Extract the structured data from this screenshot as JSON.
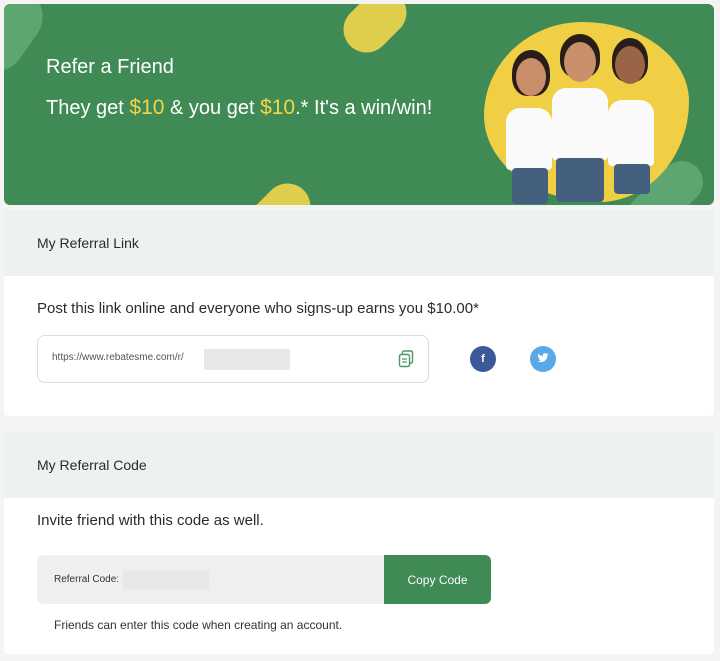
{
  "banner": {
    "title": "Refer a Friend",
    "tagline_pre": "They get ",
    "amount_friend": "$10",
    "tagline_mid": " & you get ",
    "amount_you": "$10",
    "tagline_post": ".* It's a win/win!"
  },
  "referral_link": {
    "heading": "My Referral Link",
    "description": "Post this link online and everyone who signs-up earns you $10.00*",
    "url_prefix": "https://www.rebatesme.com/r/",
    "copy_icon": "copy-icon",
    "share": [
      {
        "name": "facebook",
        "glyph": "f"
      },
      {
        "name": "twitter",
        "glyph": "t"
      }
    ]
  },
  "referral_code": {
    "heading": "My Referral Code",
    "description": "Invite friend with this code as well.",
    "label": "Referral Code:",
    "button": "Copy Code",
    "hint": "Friends can enter this code when creating an account."
  },
  "colors": {
    "brand_green": "#3f8a55",
    "accent_yellow": "#f5d547",
    "facebook": "#3b5998",
    "twitter": "#5aa9e6"
  }
}
